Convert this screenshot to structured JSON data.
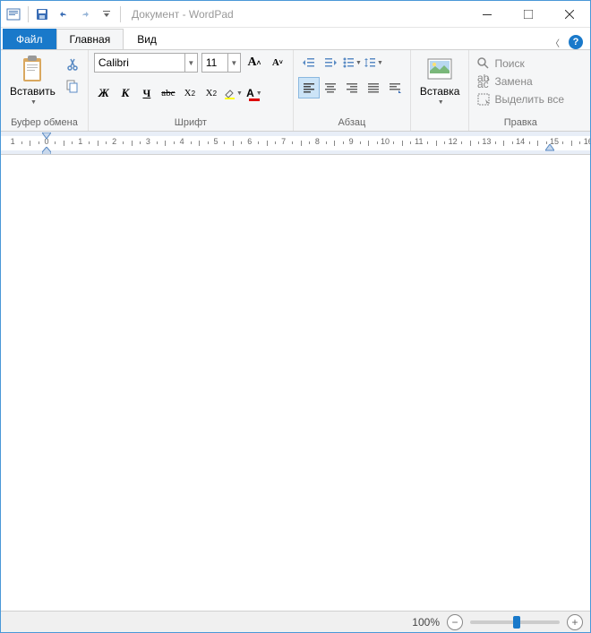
{
  "title": "Документ - WordPad",
  "tabs": {
    "file": "Файл",
    "home": "Главная",
    "view": "Вид"
  },
  "clipboard": {
    "paste": "Вставить",
    "label": "Буфер обмена"
  },
  "font": {
    "name": "Calibri",
    "size": "11",
    "label": "Шрифт",
    "grow": "A",
    "shrink": "A",
    "bold": "Ж",
    "italic": "К",
    "underline": "Ч",
    "strike": "abc",
    "sub": "X₂",
    "sup": "X²"
  },
  "paragraph": {
    "label": "Абзац"
  },
  "insert": {
    "label": "Вставка"
  },
  "editing": {
    "find": "Поиск",
    "replace": "Замена",
    "selectall": "Выделить все",
    "label": "Правка"
  },
  "status": {
    "zoom": "100%"
  }
}
